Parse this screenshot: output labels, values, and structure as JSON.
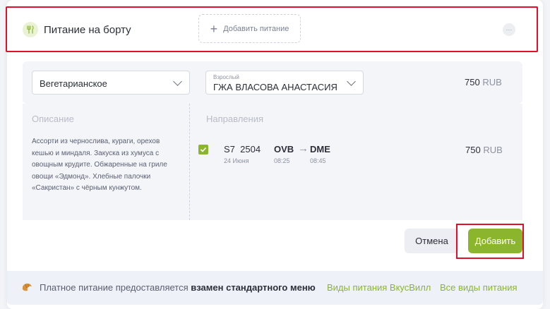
{
  "header": {
    "title": "Питание на борту",
    "add_food_label": "Добавить питание",
    "more_label": "···"
  },
  "selection": {
    "meal_type": "Вегетарианское",
    "passenger_caption": "Взрослый",
    "passenger_name": "ГЖА ВЛАСОВА АНАСТАСИЯ",
    "price_amount": "750",
    "price_currency": "RUB"
  },
  "description": {
    "title": "Описание",
    "text": "Ассорти из чернослива, кураги, орехов кешью и миндаля. Закуска из хумуса с овощным крудите. Обжаренные на гриле овощи «Эдмонд». Хлебные палочки «Сакристан» с чёрным кунжутом."
  },
  "directions": {
    "title": "Направления",
    "flight": {
      "checked": true,
      "number": "S7  2504",
      "date": "24 Июня",
      "from": "OVB",
      "to": "DME",
      "arrow": "→",
      "dep_time": "08:25",
      "arr_time": "08:45",
      "price_amount": "750",
      "price_currency": "RUB"
    }
  },
  "actions": {
    "cancel_label": "Отмена",
    "add_label": "Добавить"
  },
  "footer": {
    "text_prefix": "Платное питание предоставляется ",
    "text_bold": "взамен стандартного меню",
    "link1": "Виды питания ВкусВилл",
    "link2": "Все виды питания"
  },
  "colors": {
    "accent": "#8cb52e",
    "highlight": "#e0102a"
  }
}
